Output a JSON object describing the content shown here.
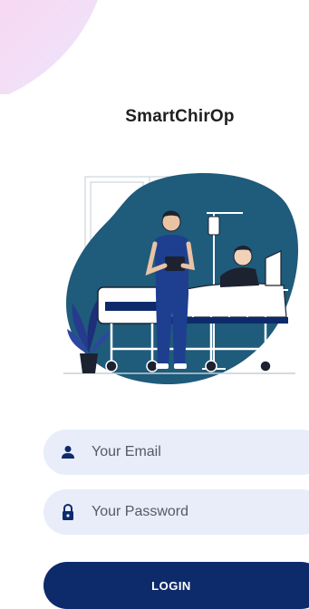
{
  "app": {
    "title": "SmartChirOp"
  },
  "login_form": {
    "email": {
      "placeholder": "Your Email",
      "value": "",
      "icon": "person-icon"
    },
    "password": {
      "placeholder": "Your Password",
      "value": "",
      "icon": "lock-icon"
    },
    "submit_label": "LOGIN"
  },
  "illustration": {
    "subject": "doctor-patient-hospital-bed"
  },
  "colors": {
    "primary": "#0d2b6b",
    "field_bg": "#e8edf9",
    "blob": "#1f5b7a",
    "corner_gradient_start": "#f6dcf3",
    "corner_gradient_end": "#e8e3fb"
  }
}
